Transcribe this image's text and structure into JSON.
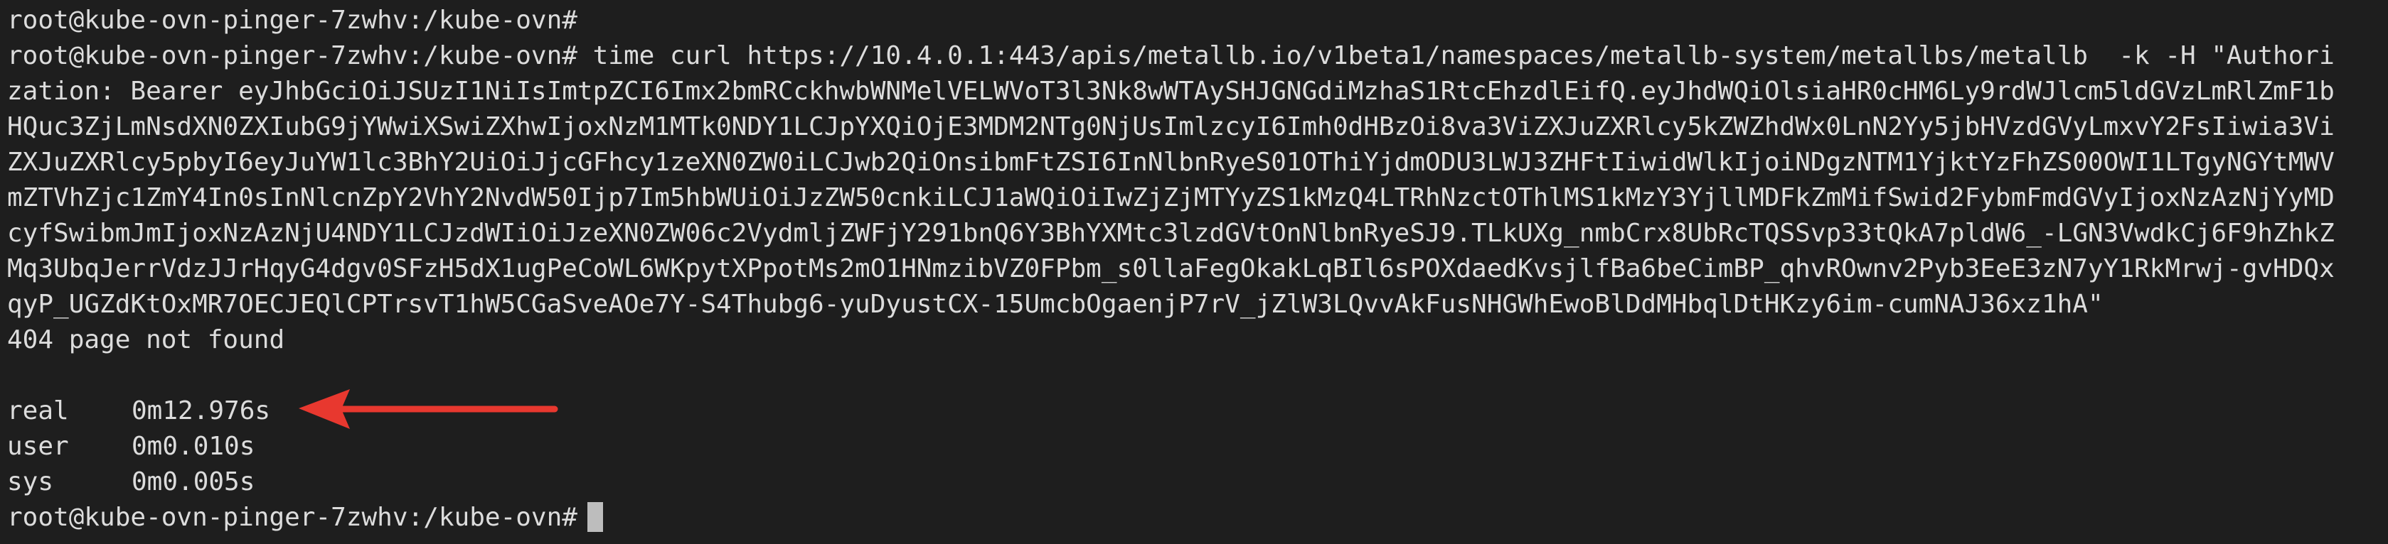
{
  "terminal": {
    "lines": [
      "root@kube-ovn-pinger-7zwhv:/kube-ovn#",
      "root@kube-ovn-pinger-7zwhv:/kube-ovn# time curl https://10.4.0.1:443/apis/metallb.io/v1beta1/namespaces/metallb-system/metallbs/metallb  -k -H \"Authori",
      "zation: Bearer eyJhbGciOiJSUzI1NiIsImtpZCI6Imx2bmRCckhwbWNMelVELWVoT3l3Nk8wWTAySHJGNGdiMzhaS1RtcEhzdlEifQ.eyJhdWQiOlsiaHR0cHM6Ly9rdWJlcm5ldGVzLmRlZmF1b",
      "HQuc3ZjLmNsdXN0ZXIubG9jYWwiXSwiZXhwIjoxNzM1MTk0NDY1LCJpYXQiOjE3MDM2NTg0NjUsImlzcyI6Imh0dHBzOi8va3ViZXJuZXRlcy5kZWZhdWx0LnN2Yy5jbHVzdGVyLmxvY2FsIiwia3Vi",
      "ZXJuZXRlcy5pbyI6eyJuYW1lc3BhY2UiOiJjcGFhcy1zeXN0ZW0iLCJwb2QiOnsibmFtZSI6InNlbnRyeS01OThiYjdmODU3LWJ3ZHFtIiwidWlkIjoiNDgzNTM1YjktYzFhZS00OWI1LTgyNGYtMWV",
      "mZTVhZjc1ZmY4In0sInNlcnZpY2VhY2NvdW50Ijp7Im5hbWUiOiJzZW50cnkiLCJ1aWQiOiIwZjZjMTYyZS1kMzQ4LTRhNzctOThlMS1kMzY3YjllMDFkZmMifSwid2FybmFmdGVyIjoxNzAzNjYyMD",
      "cyfSwibmJmIjoxNzAzNjU4NDY1LCJzdWIiOiJzeXN0ZW06c2VydmljZWFjY291bnQ6Y3BhYXMtc3lzdGVtOnNlbnRyeSJ9.TLkUXg_nmbCrx8UbRcTQSSvp33tQkA7pldW6_-LGN3VwdkCj6F9hZhkZ",
      "Mq3UbqJerrVdzJJrHqyG4dgv0SFzH5dX1ugPeCoWL6WKpytXPpotMs2mO1HNmzibVZ0FPbm_s0llaFegOkakLqBIl6sPOXdaedKvsjlfBa6beCimBP_qhvROwnv2Pyb3EeE3zN7yY1RkMrwj-gvHDQx",
      "qyP_UGZdKtOxMR7OECJEQlCPTrsvT1hW5CGaSveAOe7Y-S4Thubg6-yuDyustCX-15UmcbOgaenjP7rV_jZlW3LQvvAkFusNHGWhEwoBlDdMHbqlDtHKzy6im-cumNAJ36xz1hA\"",
      "404 page not found",
      ""
    ],
    "timing": [
      {
        "label": "real",
        "value": "0m12.976s"
      },
      {
        "label": "user",
        "value": "0m0.010s"
      },
      {
        "label": "sys",
        "value": "0m0.005s"
      }
    ],
    "final_prompt": "root@kube-ovn-pinger-7zwhv:/kube-ovn#"
  },
  "colors": {
    "background": "#1e1e1e",
    "text": "#dcdcdc",
    "arrow": "#e8382f",
    "cursor": "#bdbdbd"
  },
  "icons": {
    "annotation": "arrow-left-icon"
  }
}
